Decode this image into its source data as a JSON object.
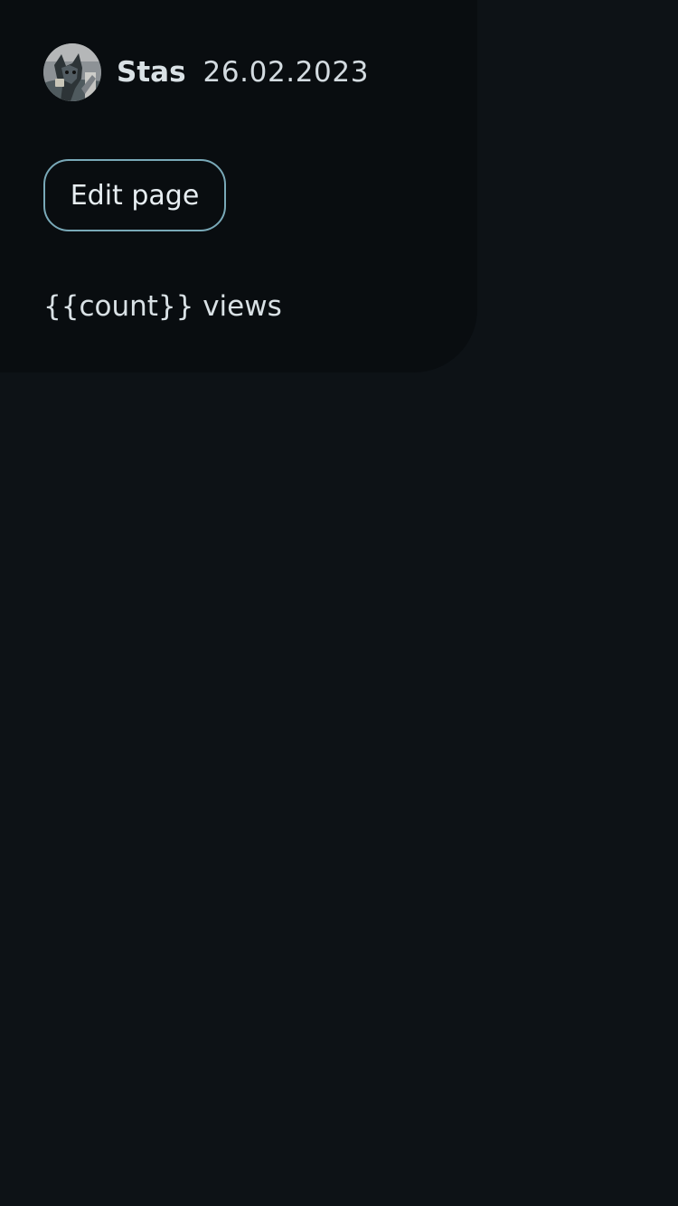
{
  "post": {
    "author": {
      "name": "Stas",
      "avatar_icon": "user-photo-avatar"
    },
    "date": "26.02.2023",
    "edit_button_label": "Edit page",
    "views_text": "{{count}} views"
  },
  "colors": {
    "background": "#0d1216",
    "card": "#090d10",
    "button_border": "#79a9b8",
    "text": "#d9e1e5"
  }
}
